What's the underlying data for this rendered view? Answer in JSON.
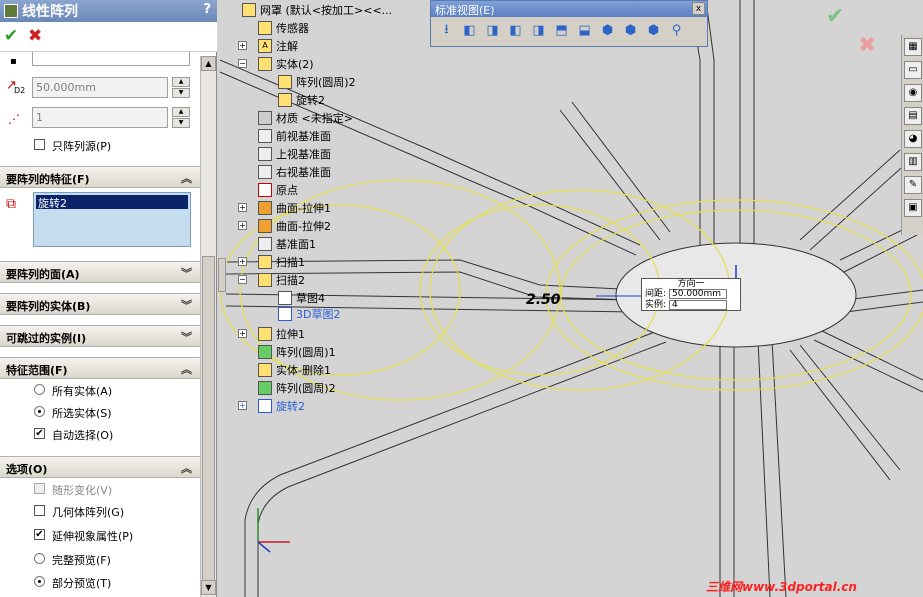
{
  "pm": {
    "title": "线性阵列",
    "help": "?",
    "d2_value": "50.000mm",
    "d2_label": "D2",
    "count_value": "1",
    "only_seed": "只阵列源(P)",
    "sections": {
      "features": "要阵列的特征(F)",
      "faces": "要阵列的面(A)",
      "bodies": "要阵列的实体(B)",
      "skip": "可跳过的实例(I)",
      "scope": "特征范围(F)",
      "options": "选项(O)"
    },
    "feature_item": "旋转2",
    "scope_all": "所有实体(A)",
    "scope_selected": "所选实体(S)",
    "auto_select": "自动选择(O)",
    "opt_vary": "随形变化(V)",
    "opt_geometry": "几何体阵列(G)",
    "opt_propagate": "延伸视象属性(P)",
    "opt_full_preview": "完整预览(F)",
    "opt_partial_preview": "部分预览(T)"
  },
  "tree": [
    {
      "label": "网罩  (默认<按加工><<...",
      "icon": "part-icon"
    },
    {
      "label": "传感器",
      "icon": "sensor-icon"
    },
    {
      "label": "注解",
      "icon": "annotation-icon"
    },
    {
      "label": "实体(2)",
      "icon": "solid-bodies-icon"
    },
    {
      "label": "阵列(圆周)2",
      "icon": "body-icon"
    },
    {
      "label": "旋转2",
      "icon": "body-icon"
    },
    {
      "label": "材质 <未指定>",
      "icon": "material-icon"
    },
    {
      "label": "前视基准面",
      "icon": "plane-icon"
    },
    {
      "label": "上视基准面",
      "icon": "plane-icon"
    },
    {
      "label": "右视基准面",
      "icon": "plane-icon"
    },
    {
      "label": "原点",
      "icon": "origin-icon"
    },
    {
      "label": "曲面-拉伸1",
      "icon": "surface-icon"
    },
    {
      "label": "曲面-拉伸2",
      "icon": "surface-icon"
    },
    {
      "label": "基准面1",
      "icon": "plane-icon"
    },
    {
      "label": "扫描1",
      "icon": "sweep-icon"
    },
    {
      "label": "扫描2",
      "icon": "sweep-icon"
    },
    {
      "label": "草图4",
      "icon": "sketch-icon"
    },
    {
      "label": "3D草图2",
      "icon": "sketch3d-icon"
    },
    {
      "label": "拉伸1",
      "icon": "extrude-icon"
    },
    {
      "label": "阵列(圆周)1",
      "icon": "pattern-icon"
    },
    {
      "label": "实体-删除1",
      "icon": "delete-body-icon"
    },
    {
      "label": "阵列(圆周)2",
      "icon": "pattern-icon"
    },
    {
      "label": "旋转2",
      "icon": "revolve-icon"
    }
  ],
  "stdview": {
    "title": "标准视图(E)",
    "close": "x"
  },
  "callout": {
    "direction": "方向一",
    "spacing_label": "间距:",
    "spacing": "50.000mm",
    "count_label": "实例:",
    "count": "4"
  },
  "dimension": "2.50",
  "watermark": "三维网www.3dportal.cn"
}
